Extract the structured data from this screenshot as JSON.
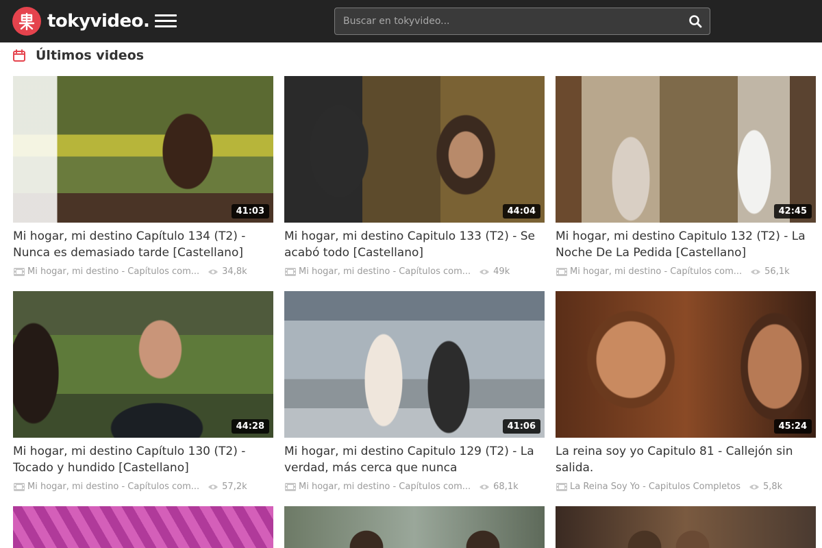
{
  "header": {
    "logo_text": "tokyvideo.",
    "search_placeholder": "Buscar en tokyvideo..."
  },
  "section": {
    "title": "Últimos videos"
  },
  "colors": {
    "brand": "#e5434d",
    "header_bg": "#232323"
  },
  "videos": [
    {
      "title": "Mi hogar, mi destino Capítulo 134 (T2) - Nunca es demasiado tarde [Castellano]",
      "duration": "41:03",
      "channel": "Mi hogar, mi destino - Capítulos com...",
      "views": "34,8k"
    },
    {
      "title": "Mi hogar, mi destino Capitulo 133 (T2) - Se acabó todo [Castellano]",
      "duration": "44:04",
      "channel": "Mi hogar, mi destino - Capítulos com...",
      "views": "49k"
    },
    {
      "title": "Mi hogar, mi destino Capitulo 132 (T2) - La Noche De La Pedida [Castellano]",
      "duration": "42:45",
      "channel": "Mi hogar, mi destino - Capítulos com...",
      "views": "56,1k"
    },
    {
      "title": "Mi hogar, mi destino Capítulo 130 (T2) - Tocado y hundido [Castellano]",
      "duration": "44:28",
      "channel": "Mi hogar, mi destino - Capítulos com...",
      "views": "57,2k"
    },
    {
      "title": "Mi hogar, mi destino Capitulo 129 (T2) - La verdad, más cerca que nunca",
      "duration": "41:06",
      "channel": "Mi hogar, mi destino - Capítulos com...",
      "views": "68,1k"
    },
    {
      "title": "La reina soy yo Capitulo 81 - Callejón sin salida.",
      "duration": "45:24",
      "channel": "La Reina Soy Yo - Capitulos Completos",
      "views": "5,8k"
    }
  ]
}
